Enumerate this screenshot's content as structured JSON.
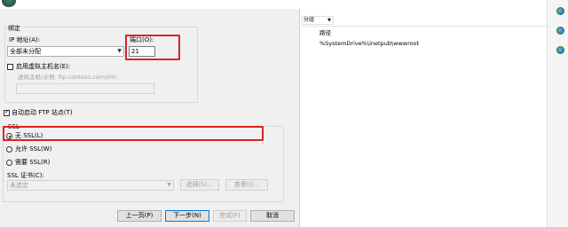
{
  "binding": {
    "group_title": "绑定",
    "ip_label": "IP 地址(A):",
    "ip_value": "全部未分配",
    "port_label": "端口(O):",
    "port_value": "21",
    "virtual_host_checkbox": "启用虚拟主机名(E):",
    "virtual_host_hint": "虚拟主机(示例: ftp.contoso.com)(H):"
  },
  "auto_start_label": "自动启动 FTP 站点(T)",
  "ssl": {
    "group_title": "SSL",
    "options": [
      "无 SSL(L)",
      "允许 SSL(W)",
      "需要 SSL(R)"
    ],
    "selected_index": 0,
    "cert_label": "SSL 证书(C):",
    "cert_value": "未选定",
    "select_button": "选择(S)...",
    "view_button": "查看(I)..."
  },
  "footer": {
    "prev": "上一页(P)",
    "next": "下一步(N)",
    "finish": "完成(F)",
    "cancel": "取消"
  },
  "right_pane": {
    "column_dropdown": "分组",
    "path_header": "路径",
    "path_value": "%SystemDrive%\\inetpub\\wwwroot"
  },
  "colors": {
    "highlight": "#e02020",
    "dialog_bg": "#f0f0f0",
    "primary_border": "#0078d7"
  }
}
